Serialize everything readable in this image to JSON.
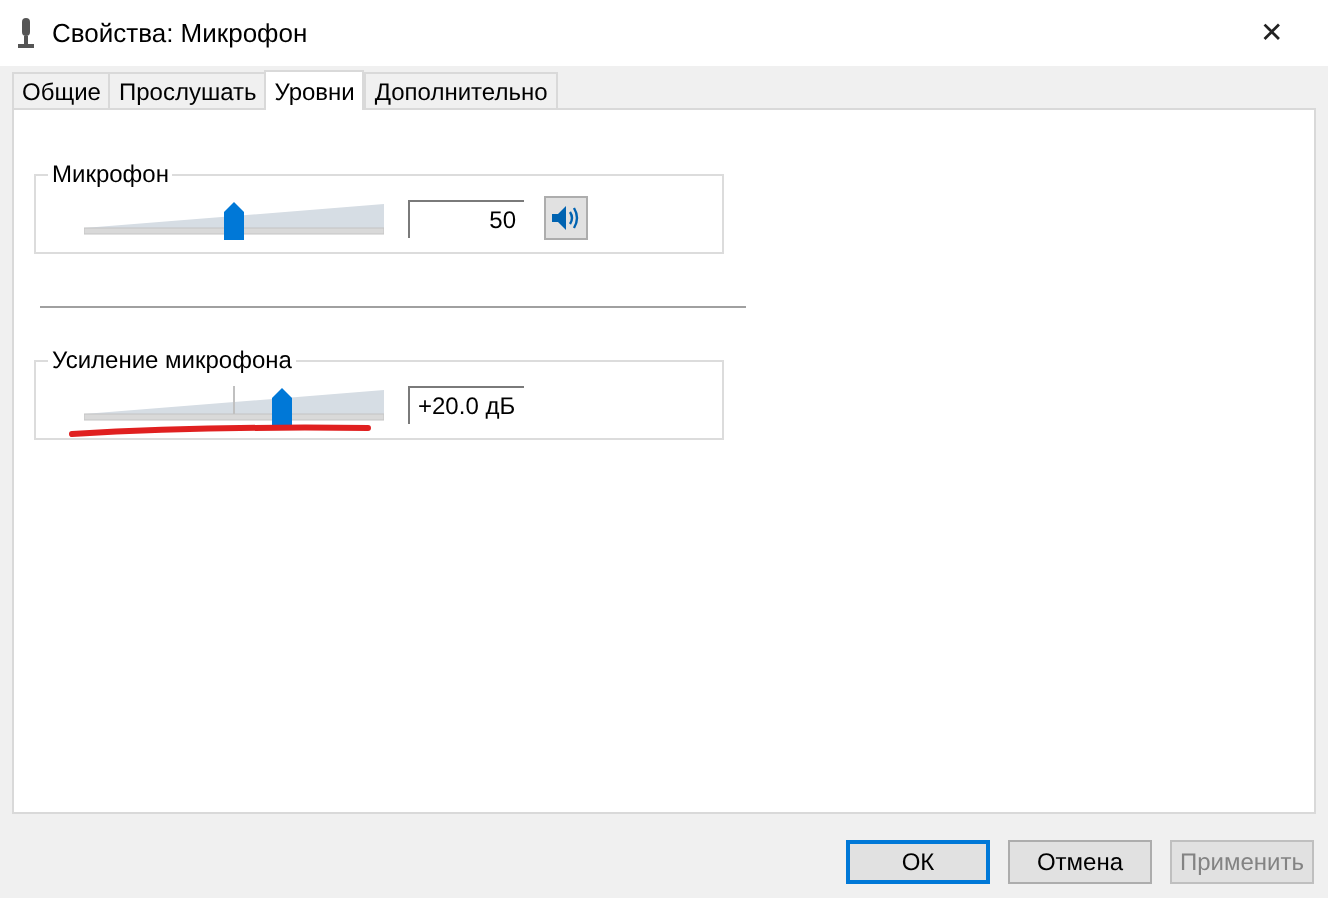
{
  "window": {
    "title": "Свойства: Микрофон",
    "close": "✕"
  },
  "tabs": [
    {
      "label": "Общие",
      "selected": false
    },
    {
      "label": "Прослушать",
      "selected": false
    },
    {
      "label": "Уровни",
      "selected": true
    },
    {
      "label": "Дополнительно",
      "selected": false
    }
  ],
  "groups": [
    {
      "kind": "volume",
      "label": "Микрофон",
      "level": 0.5,
      "reading": "50"
    },
    {
      "kind": "boost",
      "label": "Усиление микрофона",
      "reading": "+20.0 дБ"
    }
  ],
  "buttons": [
    {
      "label": "ОК",
      "default": true,
      "disabled": false
    },
    {
      "label": "Отмена",
      "default": false,
      "disabled": false
    },
    {
      "label": "Применить",
      "default": false,
      "disabled": true
    }
  ]
}
